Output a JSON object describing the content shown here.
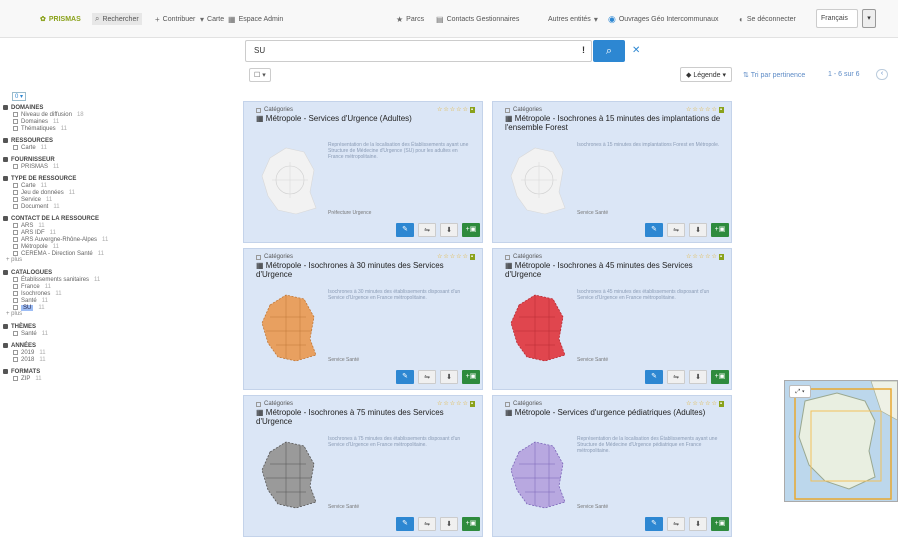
{
  "header": {
    "logo_label": "PRISMAS",
    "nav": [
      {
        "label": "Rechercher",
        "icon": "search-icon"
      },
      {
        "label": "Contribuer",
        "icon": "plus-icon"
      },
      {
        "label": "Carte",
        "icon": "map-icon"
      },
      {
        "label": "Espace Admin",
        "icon": "grid-icon"
      }
    ],
    "right_nav": [
      {
        "label": "Parcs",
        "icon": "star-icon"
      },
      {
        "label": "Contacts Gestionnaires",
        "icon": "list-icon"
      },
      {
        "label": "Autres entités",
        "icon": "menu-icon"
      },
      {
        "label": "Ouvrages Géo Intercommunaux",
        "icon": "globe-icon"
      },
      {
        "label": "Se déconnecter",
        "icon": "user-icon"
      }
    ],
    "language": "Français"
  },
  "search": {
    "value": "SU",
    "clear_icon": "times-icon"
  },
  "toolbar": {
    "select_label": "☐ ▾",
    "legend_label": "Légende ▾",
    "sort_label": "Tri par pertinence",
    "pagination": "1 - 6 sur 6",
    "pager_icon": "chevron-icon"
  },
  "sidebar": {
    "top_label": "0 ▾",
    "facets": [
      {
        "title": "DOMAINES",
        "items": [
          {
            "label": "Niveau de diffusion",
            "count": "18"
          },
          {
            "label": "Domaines",
            "count": "11"
          },
          {
            "label": "Thématiques",
            "count": "11"
          }
        ]
      },
      {
        "title": "RESSOURCES",
        "items": [
          {
            "label": "Carte",
            "count": "11"
          }
        ]
      },
      {
        "title": "FOURNISSEUR",
        "items": [
          {
            "label": "PRISMAS",
            "count": "11"
          }
        ]
      },
      {
        "title": "TYPE DE RESSOURCE",
        "items": [
          {
            "label": "Carte",
            "count": "11"
          },
          {
            "label": "Jeu de données",
            "count": "11"
          },
          {
            "label": "Service",
            "count": "11"
          },
          {
            "label": "Document",
            "count": "11"
          }
        ]
      },
      {
        "title": "CONTACT DE LA RESSOURCE",
        "items": [
          {
            "label": "ARS",
            "count": "11"
          },
          {
            "label": "ARS IDF",
            "count": "11"
          },
          {
            "label": "ARS Auvergne-Rhône-Alpes",
            "count": "11"
          },
          {
            "label": "Métropole",
            "count": "11"
          },
          {
            "label": "CEREMA - Direction Santé",
            "count": "11"
          }
        ],
        "more": "+ plus"
      },
      {
        "title": "CATALOGUES",
        "items": [
          {
            "label": "Établissements sanitaires",
            "count": "11"
          },
          {
            "label": "France",
            "count": "11"
          },
          {
            "label": "Isochrones",
            "count": "11"
          },
          {
            "label": "Santé",
            "count": "11"
          },
          {
            "label": "SU",
            "count": "11"
          }
        ],
        "more": "+ plus"
      },
      {
        "title": "THÈMES",
        "items": [
          {
            "label": "Santé",
            "count": "11"
          }
        ]
      },
      {
        "title": "ANNÉES",
        "items": [
          {
            "label": "2019",
            "count": "11"
          },
          {
            "label": "2018",
            "count": "11"
          }
        ]
      },
      {
        "title": "FORMATS",
        "items": [
          {
            "label": "ZIP",
            "count": "11"
          }
        ]
      }
    ]
  },
  "cards": [
    {
      "category": "Catégories",
      "rating": "☆☆☆☆☆",
      "title": "Métropole - Services d'Urgence (Adultes)",
      "desc": "Représentation de la localisation des Établissements ayant une Structure de Médecine d'Urgence (SU) pour les adultes en France métropolitaine.",
      "source": "Préfecture Urgence",
      "map_color": "#f2f2f2",
      "map_edge": "#d8d8d8"
    },
    {
      "category": "Catégories",
      "rating": "☆☆☆☆☆",
      "title": "Métropole - Isochrones à 15 minutes des implantations de l'ensemble Forest",
      "desc": "Isochrones à 15 minutes des implantations Forest en Métropole.",
      "source": "Service Santé",
      "map_color": "#f2f2f2",
      "map_edge": "#d8d8d8"
    },
    {
      "category": "Catégories",
      "rating": "☆☆☆☆☆",
      "title": "Métropole - Isochrones à 30 minutes des Services d'Urgence",
      "desc": "Isochrones à 30 minutes des établissements disposant d'un Service d'Urgence en France métropolitaine.",
      "source": "Service Santé",
      "map_color": "#e8a060",
      "map_edge": "#c07838"
    },
    {
      "category": "Catégories",
      "rating": "☆☆☆☆☆",
      "title": "Métropole - Isochrones à 45 minutes des Services d'Urgence",
      "desc": "Isochrones à 45 minutes des établissements disposant d'un Service d'Urgence en France métropolitaine.",
      "source": "Service Santé",
      "map_color": "#e0464e",
      "map_edge": "#b82a32"
    },
    {
      "category": "Catégories",
      "rating": "☆☆☆☆☆",
      "title": "Métropole - Isochrones à 75 minutes des Services d'Urgence",
      "desc": "Isochrones à 75 minutes des établissements disposant d'un Service d'Urgence en France métropolitaine.",
      "source": "Service Santé",
      "map_color": "#9a9a9a",
      "map_edge": "#555555"
    },
    {
      "category": "Catégories",
      "rating": "☆☆☆☆☆",
      "title": "Métropole - Services d'urgence pédiatriques (Adultes)",
      "desc": "Représentation de la localisation des Établissements ayant une Structure de Médecine d'Urgence pédiatrique en France métropolitaine.",
      "source": "Service Santé",
      "map_color": "#b8a8e0",
      "map_edge": "#7a64b8"
    }
  ],
  "card_actions": [
    {
      "icon": "pencil-icon",
      "glyph": "✎"
    },
    {
      "icon": "share-icon",
      "glyph": "⇋"
    },
    {
      "icon": "download-icon",
      "glyph": "⬇"
    },
    {
      "icon": "add-to-map-icon",
      "glyph": "+▣"
    }
  ],
  "minimap": {
    "zoom_label": "⤢ ▾"
  },
  "colors": {
    "accent": "#2d87d2",
    "card_bg": "#dbe6f6",
    "add_green": "#2e8b3d",
    "logo_green": "#8aa21b",
    "star": "#e6b020"
  }
}
